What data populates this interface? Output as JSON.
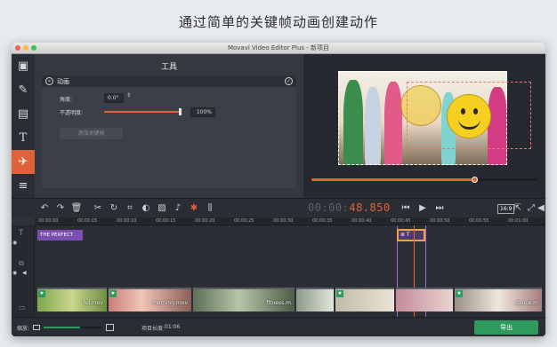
{
  "headline": "通过简单的关键帧动画创建动作",
  "window": {
    "title": "Movavi Video Editor Plus - 新项目"
  },
  "sidebar": {
    "items": [
      {
        "name": "import",
        "icon": "film-import-icon"
      },
      {
        "name": "filters",
        "icon": "magic-wand-icon"
      },
      {
        "name": "transitions",
        "icon": "transitions-icon"
      },
      {
        "name": "titles",
        "icon": "text-T-icon"
      },
      {
        "name": "animation",
        "icon": "running-man-icon",
        "active": true
      },
      {
        "name": "more",
        "icon": "list-icon"
      }
    ]
  },
  "tools": {
    "title": "工具",
    "panel_title": "动画",
    "angle_label": "角度:",
    "angle_value": "0.0°",
    "opacity_label": "不透明度:",
    "opacity_value": "100%",
    "opacity_level": 1.0,
    "add_keyframe_label": "添加关键帧"
  },
  "player": {
    "timecode_main": "00:00:",
    "timecode_highlight": "48.850",
    "aspect_ratio": "16:9",
    "progress": 0.72
  },
  "timeline": {
    "ticks": [
      "00:00:00",
      "00:00:05",
      "00:00:10",
      "00:00:15",
      "00:00:20",
      "00:00:25",
      "00:00:30",
      "00:00:35",
      "00:00:40",
      "00:00:45",
      "00:00:50",
      "00:00:55",
      "00:01:00"
    ],
    "title_clip": "THE PERFECT",
    "clips": [
      {
        "label": "hd.mov"
      },
      {
        "label": "morning.mov"
      },
      {
        "label": "fitness.m"
      },
      {
        "label": ""
      },
      {
        "label": "dance.m"
      }
    ]
  },
  "status": {
    "zoom_label": "缩放:",
    "duration_label": "项目长度:",
    "duration_value": "01:06",
    "export_label": "导出"
  },
  "colors": {
    "accent": "#e0623a",
    "export": "#2d9b5e",
    "title_clip": "#7a4fb0"
  }
}
